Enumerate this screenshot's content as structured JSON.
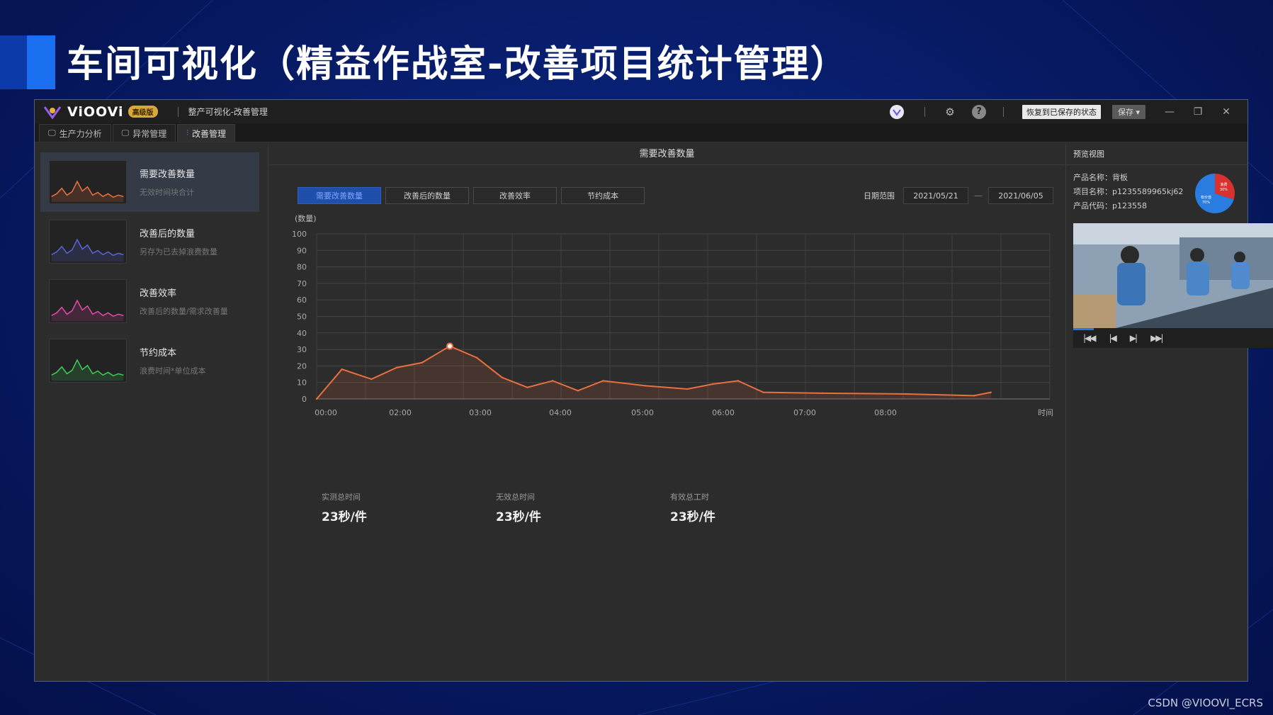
{
  "slide": {
    "title": "车间可视化（精益作战室-改善项目统计管理）",
    "watermark": "CSDN @VIOOVI_ECRS"
  },
  "app": {
    "name": "ViOOVi",
    "edition": "高级版",
    "window_title": "整产可视化-改善管理",
    "restore_label": "恢复到已保存的状态",
    "save_label": "保存",
    "tabs": [
      {
        "label": "生产力分析"
      },
      {
        "label": "异常管理"
      },
      {
        "label": "改善管理"
      }
    ]
  },
  "sidebar": {
    "items": [
      {
        "name": "需要改善数量",
        "desc": "无效时间块合计",
        "color": "#e8703f"
      },
      {
        "name": "改善后的数量",
        "desc": "另存为已去掉浪费数量",
        "color": "#5a63d8"
      },
      {
        "name": "改善效率",
        "desc": "改善后的数量/需求改善量",
        "color": "#e04aa8"
      },
      {
        "name": "节约成本",
        "desc": "浪费时间*单位成本",
        "color": "#3ec95a"
      }
    ]
  },
  "main": {
    "header": "需要改善数量",
    "segments": [
      "需要改善数量",
      "改善后的数量",
      "改善效率",
      "节约成本"
    ],
    "date_label": "日期范围",
    "date_from": "2021/05/21",
    "date_sep": "—",
    "date_to": "2021/06/05",
    "stats": [
      {
        "label": "实测总时间",
        "value": "23秒/件"
      },
      {
        "label": "无效总时间",
        "value": "23秒/件"
      },
      {
        "label": "有效总工时",
        "value": "23秒/件"
      }
    ]
  },
  "chart_data": {
    "type": "area",
    "ylabel": "(数量)",
    "xlabel": "时间",
    "ylim": [
      0,
      100
    ],
    "yticks": [
      0,
      10,
      20,
      30,
      40,
      50,
      60,
      70,
      80,
      90,
      100
    ],
    "xticks": [
      "00:00",
      "02:00",
      "03:00",
      "04:00",
      "05:00",
      "06:00",
      "07:00",
      "08:00"
    ],
    "xlim": [
      0,
      8.7
    ],
    "x": [
      0,
      0.3,
      0.65,
      0.95,
      1.25,
      1.58,
      1.9,
      2.2,
      2.5,
      2.8,
      3.1,
      3.4,
      3.9,
      4.4,
      4.7,
      5.0,
      5.3,
      6.0,
      7.0,
      7.8,
      8.0
    ],
    "values": [
      0,
      18,
      12,
      19,
      22,
      32,
      25,
      13,
      7,
      11,
      5,
      11,
      8,
      6,
      9,
      11,
      4,
      3.5,
      3,
      2,
      4
    ],
    "highlight_index": 5,
    "color": "#e8703f",
    "grid": true
  },
  "preview": {
    "header": "预览视图",
    "product_name_label": "产品名称：",
    "product_name": "背板",
    "project_name_label": "项目名称：",
    "project_name": "p1235589965kj62",
    "product_code_label": "产品代码：",
    "product_code": "p123558",
    "pie": [
      {
        "label": "浪费",
        "pct": "30%",
        "value": 30,
        "color": "#d8322e"
      },
      {
        "label": "有价值",
        "pct": "70%",
        "value": 70,
        "color": "#2a7de0"
      }
    ],
    "video_progress": 0.1
  }
}
